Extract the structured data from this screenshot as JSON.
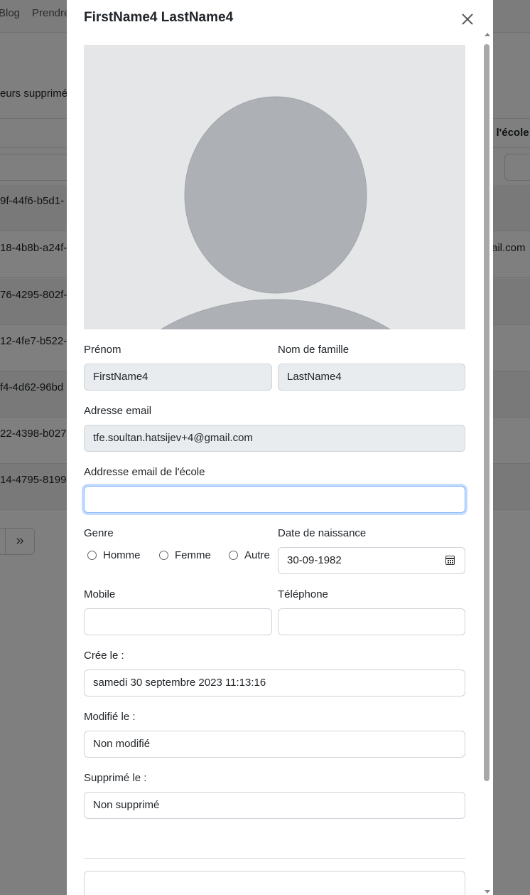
{
  "background": {
    "nav_items": [
      "Blog",
      "Prendre"
    ],
    "deleted_text": "eurs supprimé",
    "column_header": "e l'école",
    "row_ids": [
      "9f-44f6-b5d1-",
      "18-4b8b-a24f-",
      "76-4295-802f-",
      "12-4fe7-b522-",
      "f4-4d62-96bd",
      "22-4398-b027-",
      "14-4795-8199"
    ],
    "email_fragment": "ail.com",
    "pager_last": "»"
  },
  "modal": {
    "title": "FirstName4 LastName4",
    "close_icon": "close-icon",
    "avatar_icon": "person-placeholder-icon",
    "colors": {
      "avatar_bg": "#e5e6e8",
      "avatar_fg": "#adb1b5",
      "focus_border": "#86b7fe",
      "readonly_bg": "#e9ecef"
    },
    "fields": {
      "first_name": {
        "label": "Prénom",
        "value": "FirstName4"
      },
      "last_name": {
        "label": "Nom de famille",
        "value": "LastName4"
      },
      "email": {
        "label": "Adresse email",
        "value": "tfe.soultan.hatsijev+4@gmail.com"
      },
      "school_email": {
        "label": "Addresse email de l'école",
        "value": ""
      },
      "gender": {
        "label": "Genre",
        "options": [
          "Homme",
          "Femme",
          "Autre"
        ]
      },
      "birth_date": {
        "label": "Date de naissance",
        "value": "30-09-1982",
        "icon": "calendar-icon"
      },
      "mobile": {
        "label": "Mobile",
        "value": ""
      },
      "phone": {
        "label": "Téléphone",
        "value": ""
      },
      "created": {
        "label": "Crée le :",
        "value": "samedi 30 septembre 2023 11:13:16"
      },
      "modified": {
        "label": "Modifié le :",
        "value": "Non modifié"
      },
      "deleted": {
        "label": "Supprimé le :",
        "value": "Non supprimé"
      },
      "footer_field": {
        "value": ""
      }
    }
  }
}
